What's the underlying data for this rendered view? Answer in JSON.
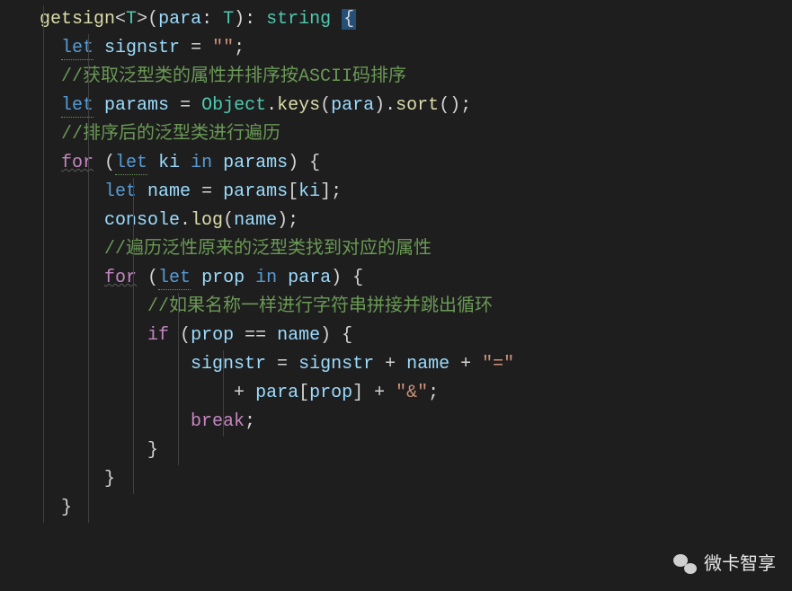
{
  "code": {
    "l1_func": "getsign",
    "l1_open_gen": "<",
    "l1_T": "T",
    "l1_close_gen": ">(",
    "l1_para": "para",
    "l1_colon": ": ",
    "l1_T2": "T",
    "l1_paren": "): ",
    "l1_string": "string",
    "l1_sp": " ",
    "l1_brace": "{",
    "l2_indent": "    ",
    "l2_let": "let",
    "l2_sp1": " ",
    "l2_var": "signstr",
    "l2_eq": " = ",
    "l2_str": "\"\"",
    "l2_semi": ";",
    "l3_indent": "    ",
    "l3_comment": "//获取泛型类的属性并排序按ASCII码排序",
    "l4_indent": "    ",
    "l4_let": "let",
    "l4_sp1": " ",
    "l4_var": "params",
    "l4_eq": " = ",
    "l4_obj": "Object",
    "l4_dot1": ".",
    "l4_keys": "keys",
    "l4_p1": "(",
    "l4_para": "para",
    "l4_p2": ").",
    "l4_sort": "sort",
    "l4_p3": "();",
    "l5_indent": "    ",
    "l5_comment": "//排序后的泛型类进行遍历",
    "l6_indent": "    ",
    "l6_for": "for",
    "l6_sp1": " (",
    "l6_let": "let",
    "l6_sp2": " ",
    "l6_ki": "ki",
    "l6_in": " in ",
    "l6_params": "params",
    "l6_end": ") {",
    "l7_indent": "        ",
    "l7_let": "let",
    "l7_sp1": " ",
    "l7_name": "name",
    "l7_eq": " = ",
    "l7_params": "params",
    "l7_br1": "[",
    "l7_ki": "ki",
    "l7_br2": "];",
    "l8_indent": "        ",
    "l8_console": "console",
    "l8_dot": ".",
    "l8_log": "log",
    "l8_p1": "(",
    "l8_name": "name",
    "l8_p2": ");",
    "l9_indent": "        ",
    "l9_comment": "//遍历泛性原来的泛型类找到对应的属性",
    "l10_indent": "        ",
    "l10_for": "for",
    "l10_sp1": " (",
    "l10_let": "let",
    "l10_sp2": " ",
    "l10_prop": "prop",
    "l10_in": " in ",
    "l10_para": "para",
    "l10_end": ") {",
    "l11_indent": "            ",
    "l11_comment": "//如果名称一样进行字符串拼接并跳出循环",
    "l12_indent": "            ",
    "l12_if": "if",
    "l12_sp": " (",
    "l12_prop": "prop",
    "l12_eq": " == ",
    "l12_name": "name",
    "l12_end": ") {",
    "l13_indent": "                ",
    "l13_signstr": "signstr",
    "l13_eq": " = ",
    "l13_signstr2": "signstr",
    "l13_plus1": " + ",
    "l13_name": "name",
    "l13_plus2": " + ",
    "l13_str": "\"=\"",
    "l14_indent": "                    ",
    "l14_plus": "+ ",
    "l14_para": "para",
    "l14_br1": "[",
    "l14_prop": "prop",
    "l14_br2": "] + ",
    "l14_str": "\"&\"",
    "l14_semi": ";",
    "l15_indent": "                ",
    "l15_break": "break",
    "l15_semi": ";",
    "l16_indent": "            ",
    "l16_brace": "}",
    "l17_indent": "        ",
    "l17_brace": "}",
    "l18_indent": "    ",
    "l18_brace": "}"
  },
  "watermark": {
    "text": "微卡智享"
  }
}
